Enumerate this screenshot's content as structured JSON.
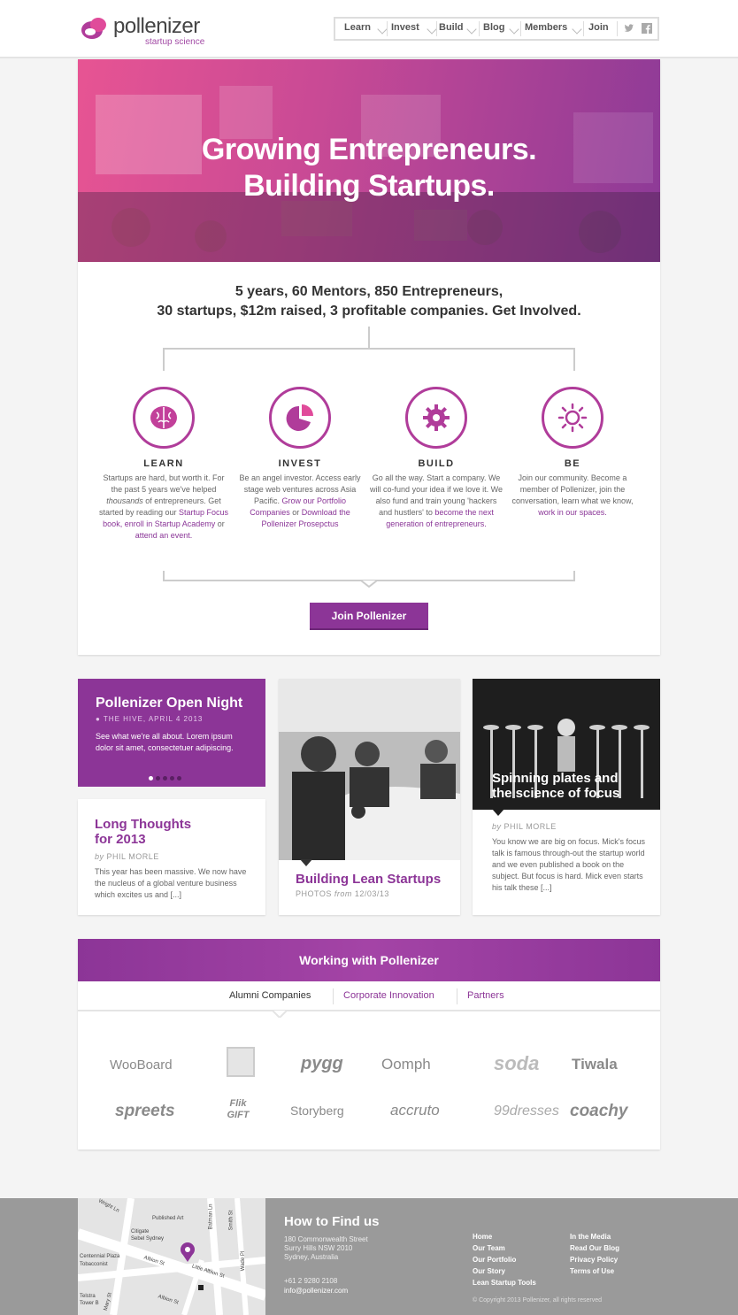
{
  "brand": {
    "name": "pollenizer",
    "tagline": "startup science",
    "color": "#8c3597"
  },
  "nav": {
    "items": [
      "Learn",
      "Invest",
      "Build",
      "Blog",
      "Members",
      "Join"
    ],
    "social": [
      "twitter-icon",
      "facebook-icon"
    ]
  },
  "hero": {
    "line1": "Growing Entrepreneurs.",
    "line2": "Building Startups."
  },
  "stats": {
    "line1": "5 years, 60 Mentors, 850 Entrepreneurs,",
    "line2": "30 startups, $12m raised, 3 profitable companies. Get Involved."
  },
  "columns": [
    {
      "icon": "brain-icon",
      "title": "LEARN",
      "p1": "Startups are hard, but worth it. For the past 5 years we've helped",
      "em": "thousands",
      "p2": "of entrepreneurs. Get started by reading our",
      "l1": "Startup Focus book,",
      "l2": "enroll in Startup Academy",
      "p3": "or",
      "l3": "attend an event."
    },
    {
      "icon": "pie-chart-icon",
      "title": "INVEST",
      "p1": "Be an angel investor. Access early stage web ventures across Asia Pacific.",
      "l1": "Grow our Portfolio Companies",
      "p2": "or",
      "l2": "Download the Pollenizer Prosepctus"
    },
    {
      "icon": "gear-icon",
      "title": "BUILD",
      "p1": "Go all the way. Start a company. We will co-fund your idea if we love it. We also fund and train young 'hackers and hustlers' to",
      "l1": "become the next generation of entrepreneurs."
    },
    {
      "icon": "sun-icon",
      "title": "BE",
      "p1": "Join our community. Become a member of Pollenizer, join the conversation, learn what we know,",
      "l1": "work in our spaces."
    }
  ],
  "join_button": "Join Pollenizer",
  "event": {
    "title": "Pollenizer Open Night",
    "meta": "THE HIVE, APRIL 4 2013",
    "desc": "See what we're all about. Lorem ipsum dolor sit amet, consectetuer adipiscing."
  },
  "long_thoughts": {
    "title1": "Long Thoughts",
    "title2": "for 2013",
    "by": "by",
    "author": "PHIL MORLE",
    "body": "This year has been massive. We now have the nucleus of a global venture business which excites us and [...]"
  },
  "lean": {
    "title": "Building Lean Startups",
    "meta1": "PHOTOS",
    "meta2": "from",
    "meta3": "12/03/13"
  },
  "spinning": {
    "title1": "Spinning plates and",
    "title2": "the science of focus",
    "by": "by",
    "author": "PHIL MORLE",
    "body": "You know we are big on focus. Mick's focus talk is famous through-out the startup world and we even published a book on the subject.  But focus is hard. Mick even starts his talk these [...]"
  },
  "working": {
    "title": "Working with Pollenizer",
    "tabs": [
      "Alumni Companies",
      "Corporate Innovation",
      "Partners"
    ],
    "logos_row1": [
      "WooBoard",
      "",
      "pygg",
      "Oomph",
      "soda",
      "Tiwala"
    ],
    "logos_row2": [
      "spreets",
      "Flik GIFT",
      "Storyberg",
      "accruto",
      "99dresses",
      "coachy"
    ]
  },
  "footer": {
    "title": "How to Find us",
    "address": [
      "180 Commonwealth Street",
      "Surry Hills NSW 2010",
      "Sydney, Australia"
    ],
    "phone": "+61 2 9280 2108",
    "email": "info@pollenizer.com",
    "links_col1": [
      "Home",
      "Our Team",
      "Our Portfolio",
      "Our Story",
      "Lean Startup Tools"
    ],
    "links_col2": [
      "In the Media",
      "Read Our Blog",
      "Privacy Policy",
      "Terms of Use"
    ],
    "copyright": "© Copyright 2013 Pollenizer, all rights reserved",
    "map_labels": [
      "Wright Ln",
      "Published Art",
      "Citigate",
      "Sebel Sydney",
      "Batman Ln",
      "Smith St",
      "Centennial Plaza",
      "Tobacconist",
      "Albion St",
      "Little Albion St",
      "Wade Pl",
      "Telstra",
      "Tower B",
      "Mary St",
      "Albion St"
    ]
  }
}
